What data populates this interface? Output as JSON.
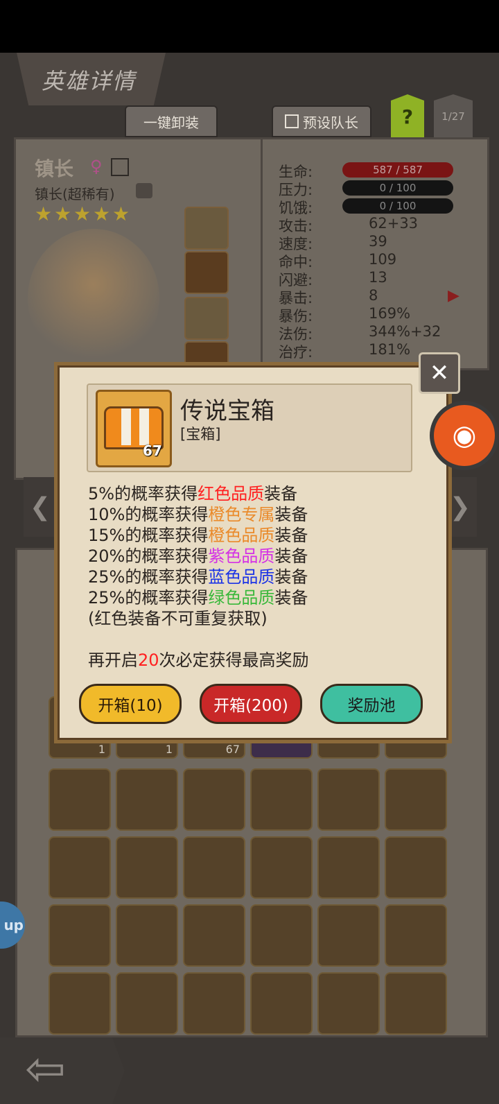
{
  "screen": {
    "title": "英雄详情",
    "unequip_all_label": "一键卸装",
    "preset_leader_label": "预设队长",
    "help_label": "?",
    "page_indicator": "1/27"
  },
  "hero": {
    "name": "镇长",
    "subtitle": "镇长(超稀有)",
    "stars": [
      "★",
      "★",
      "★",
      "★",
      "★"
    ]
  },
  "stats": {
    "labels": [
      "生命:",
      "压力:",
      "饥饿:",
      "攻击:",
      "速度:",
      "命中:",
      "闪避:",
      "暴击:",
      "暴伤:",
      "法伤:",
      "治疗:"
    ],
    "hp": "587 / 587",
    "stress": "0 / 100",
    "hunger": "0 / 100",
    "values": [
      "62+33",
      "39",
      "109",
      "13",
      "8",
      "169%",
      "344%+32",
      "181%"
    ]
  },
  "inventory": {
    "counts": [
      "1",
      "1",
      "67"
    ]
  },
  "modal": {
    "item_name": "传说宝箱",
    "item_type": "[宝箱]",
    "item_count": "67",
    "lines": [
      {
        "pre": "5%的概率获得",
        "mid": "红色品质",
        "post": "装备",
        "color": "#ff2020"
      },
      {
        "pre": "10%的概率获得",
        "mid": "橙色专属",
        "post": "装备",
        "color": "#ea8a2a"
      },
      {
        "pre": "15%的概率获得",
        "mid": "橙色品质",
        "post": "装备",
        "color": "#ea8a2a"
      },
      {
        "pre": "20%的概率获得",
        "mid": "紫色品质",
        "post": "装备",
        "color": "#d430e6"
      },
      {
        "pre": "25%的概率获得",
        "mid": "蓝色品质",
        "post": "装备",
        "color": "#1c33e6"
      },
      {
        "pre": "25%的概率获得",
        "mid": "绿色品质",
        "post": "装备",
        "color": "#38b83a"
      }
    ],
    "note": "(红色装备不可重复获取)",
    "guarantee_pre": "再开启",
    "guarantee_num": "20",
    "guarantee_post": "次必定获得最高奖励",
    "btn_open10": "开箱(10)",
    "btn_open200": "开箱(200)",
    "btn_pool": "奖励池"
  },
  "floating": {
    "app_tag": "up"
  }
}
